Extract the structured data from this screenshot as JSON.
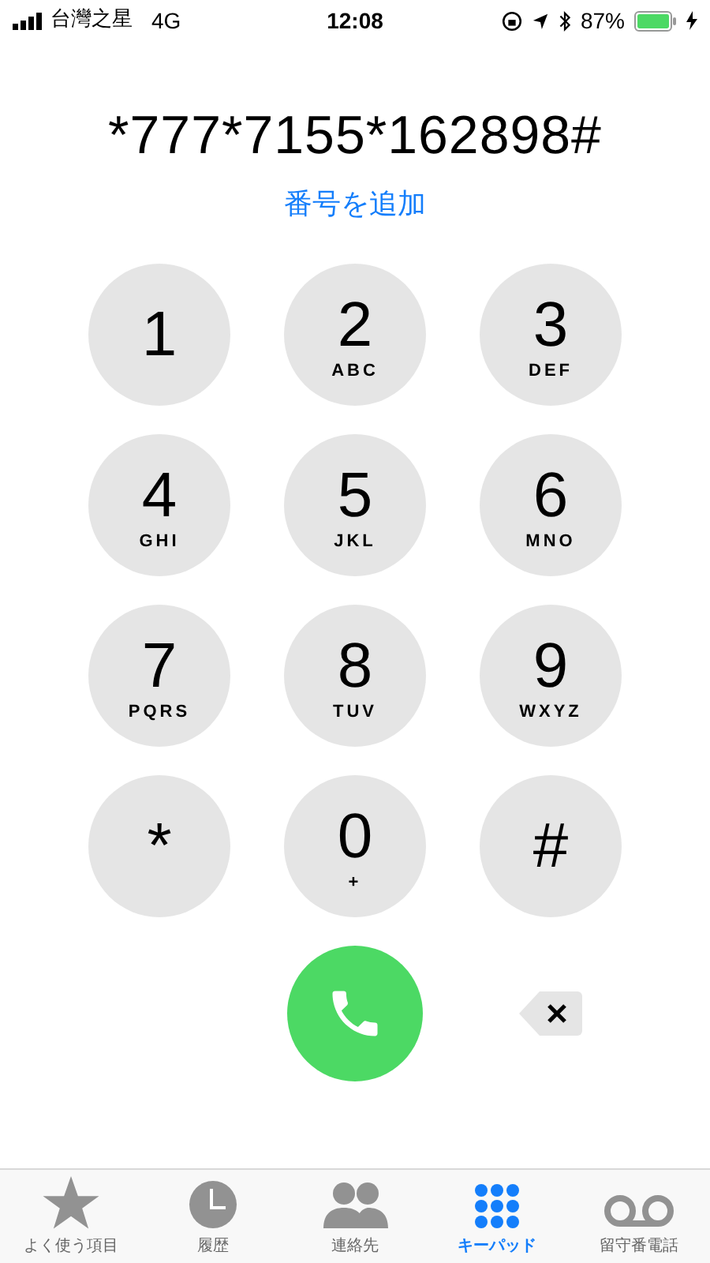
{
  "status_bar": {
    "carrier": "台灣之星",
    "network": "4G",
    "time": "12:08",
    "battery": "87%"
  },
  "number": "*777*7155*162898#",
  "add_number": "番号を追加",
  "keys": [
    {
      "digit": "1"
    },
    {
      "digit": "2",
      "letters": "ABC"
    },
    {
      "digit": "3",
      "letters": "DEF"
    },
    {
      "digit": "4",
      "letters": "GHI"
    },
    {
      "digit": "5",
      "letters": "JKL"
    },
    {
      "digit": "6",
      "letters": "MNO"
    },
    {
      "digit": "7",
      "letters": "PQRS"
    },
    {
      "digit": "8",
      "letters": "TUV"
    },
    {
      "digit": "9",
      "letters": "WXYZ"
    },
    {
      "digit": "*"
    },
    {
      "digit": "0",
      "letters": "+"
    },
    {
      "digit": "#"
    }
  ],
  "tabs": [
    {
      "kind": "star",
      "label": "よく使う項目",
      "selected": false
    },
    {
      "kind": "clock",
      "label": "履歴",
      "selected": false
    },
    {
      "kind": "people",
      "label": "連絡先",
      "selected": false
    },
    {
      "kind": "keypad",
      "label": "キーパッド",
      "selected": true
    },
    {
      "kind": "voicemail",
      "label": "留守番電話",
      "selected": false
    }
  ]
}
